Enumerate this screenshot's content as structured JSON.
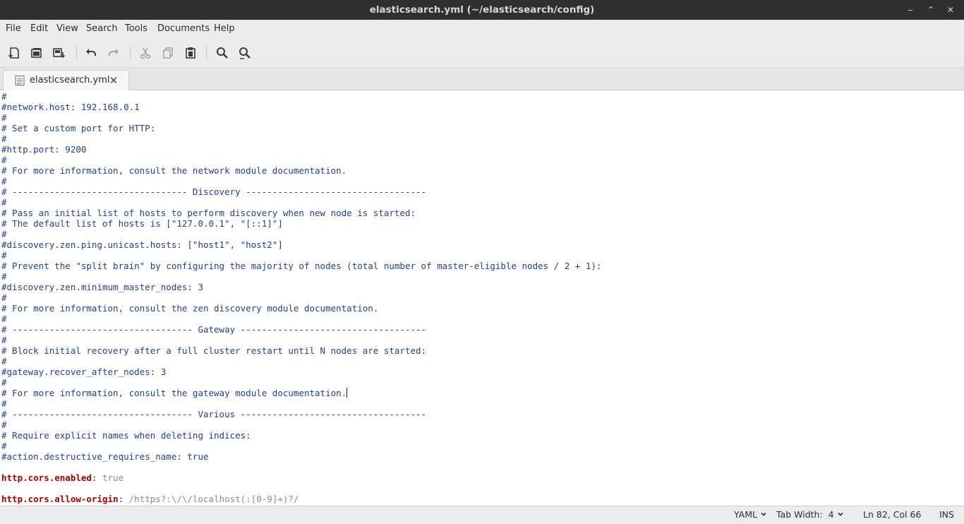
{
  "window": {
    "title": "elasticsearch.yml (~/elasticsearch/config)",
    "minimize_glyph": "‒",
    "restore_glyph": "⌃",
    "close_glyph": "✕"
  },
  "menu": {
    "items": [
      "File",
      "Edit",
      "View",
      "Search",
      "Tools",
      "Documents",
      "Help"
    ]
  },
  "toolbar": {
    "buttons": [
      "new-document-icon",
      "open-document-icon",
      "save-document-icon",
      "undo-icon",
      "redo-icon",
      "cut-icon",
      "copy-icon",
      "paste-icon",
      "find-icon",
      "find-replace-icon"
    ]
  },
  "tab": {
    "label": "elasticsearch.yml",
    "close_glyph": "✕"
  },
  "editor": {
    "lines": [
      "#",
      "#network.host: 192.168.0.1",
      "#",
      "# Set a custom port for HTTP:",
      "#",
      "#http.port: 9200",
      "#",
      "# For more information, consult the network module documentation.",
      "#",
      "# --------------------------------- Discovery ----------------------------------",
      "#",
      "# Pass an initial list of hosts to perform discovery when new node is started:",
      "# The default list of hosts is [\"127.0.0.1\", \"[::1]\"]",
      "#",
      "#discovery.zen.ping.unicast.hosts: [\"host1\", \"host2\"]",
      "#",
      "# Prevent the \"split brain\" by configuring the majority of nodes (total number of master-eligible nodes / 2 + 1):",
      "#",
      "#discovery.zen.minimum_master_nodes: 3",
      "#",
      "# For more information, consult the zen discovery module documentation.",
      "#",
      "# ---------------------------------- Gateway -----------------------------------",
      "#",
      "# Block initial recovery after a full cluster restart until N nodes are started:",
      "#",
      "#gateway.recover_after_nodes: 3",
      "#",
      "# For more information, consult the gateway module documentation.",
      "#",
      "# ---------------------------------- Various -----------------------------------",
      "#",
      "# Require explicit names when deleting indices:",
      "#",
      "#action.destructive_requires_name: true"
    ],
    "yaml_entries": [
      {
        "key": "http.cors.enabled",
        "value": "true"
      },
      {
        "key": "http.cors.allow-origin",
        "value": "/https?:\\/\\/localhost(:[0-9]+)?/"
      }
    ],
    "colors": {
      "comment": "#23418b",
      "key": "#a40000",
      "value": "#a57ca9"
    }
  },
  "statusbar": {
    "language": "YAML",
    "tab_width": "Tab Width:  4",
    "position": "Ln 82, Col 66",
    "mode": "INS"
  }
}
